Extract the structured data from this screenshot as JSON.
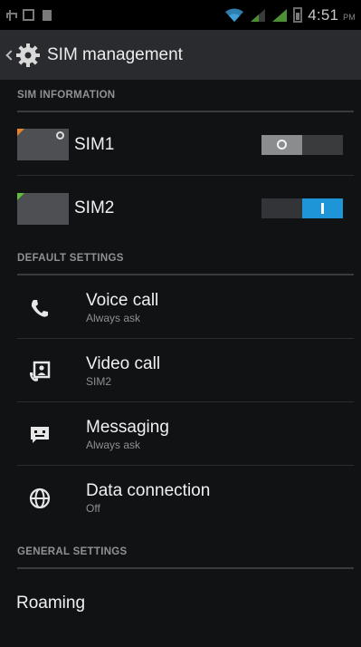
{
  "status_bar": {
    "time": "4:51",
    "ampm": "PM",
    "icons": [
      "usb-icon",
      "picture-icon",
      "storage-icon",
      "wifi-icon",
      "signal-icon",
      "signal-icon",
      "battery-icon"
    ]
  },
  "action_bar": {
    "title": "SIM management",
    "icon": "gear-icon"
  },
  "sections": {
    "sim_information": "SIM INFORMATION",
    "default_settings": "DEFAULT SETTINGS",
    "general_settings": "GENERAL SETTINGS"
  },
  "sims": [
    {
      "label": "SIM1",
      "enabled": false,
      "corner_color": "#e8812b"
    },
    {
      "label": "SIM2",
      "enabled": true,
      "corner_color": "#5fbf3b"
    }
  ],
  "default_settings": [
    {
      "title": "Voice call",
      "subtitle": "Always ask",
      "icon": "phone-icon"
    },
    {
      "title": "Video call",
      "subtitle": "SIM2",
      "icon": "video-call-icon"
    },
    {
      "title": "Messaging",
      "subtitle": "Always ask",
      "icon": "message-icon"
    },
    {
      "title": "Data connection",
      "subtitle": "Off",
      "icon": "globe-icon"
    }
  ],
  "general_settings": [
    {
      "title": "Roaming"
    }
  ],
  "colors": {
    "accent": "#1e95d6",
    "background": "#111214",
    "action_bar": "#2a2b2e"
  }
}
